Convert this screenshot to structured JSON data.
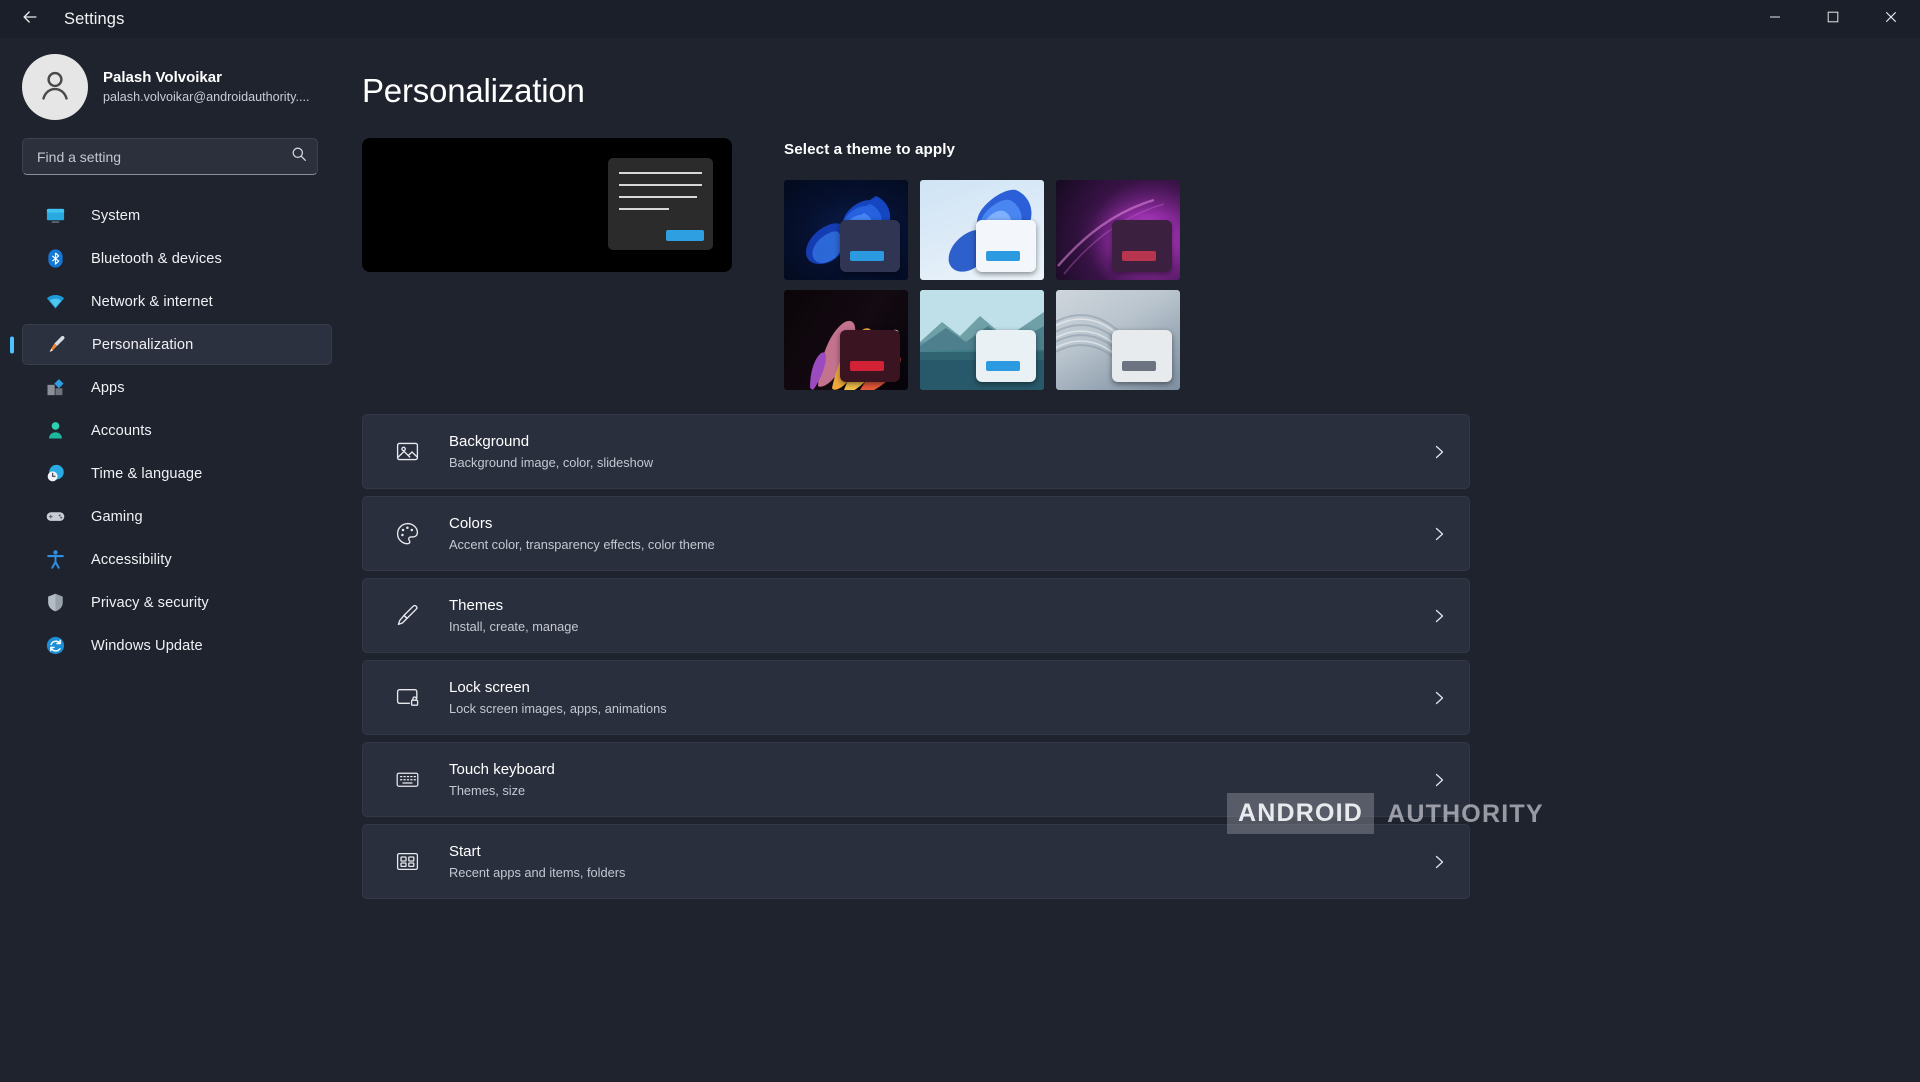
{
  "window": {
    "title": "Settings",
    "back_icon": "back-arrow-icon",
    "minimize_label": "–",
    "maximize_label": "☐",
    "close_label": "✕"
  },
  "account": {
    "name": "Palash Volvoikar",
    "email": "palash.volvoikar@androidauthority....",
    "avatar_icon": "user-avatar-icon"
  },
  "search": {
    "placeholder": "Find a setting",
    "value": "",
    "icon": "search-icon"
  },
  "sidebar": {
    "items": [
      {
        "label": "System",
        "icon": "system-monitor-icon",
        "active": false
      },
      {
        "label": "Bluetooth & devices",
        "icon": "bluetooth-icon",
        "active": false
      },
      {
        "label": "Network & internet",
        "icon": "wifi-icon",
        "active": false
      },
      {
        "label": "Personalization",
        "icon": "paintbrush-icon",
        "active": true
      },
      {
        "label": "Apps",
        "icon": "apps-icon",
        "active": false
      },
      {
        "label": "Accounts",
        "icon": "account-person-icon",
        "active": false
      },
      {
        "label": "Time & language",
        "icon": "clock-globe-icon",
        "active": false
      },
      {
        "label": "Gaming",
        "icon": "gamepad-icon",
        "active": false
      },
      {
        "label": "Accessibility",
        "icon": "accessibility-person-icon",
        "active": false
      },
      {
        "label": "Privacy & security",
        "icon": "shield-icon",
        "active": false
      },
      {
        "label": "Windows Update",
        "icon": "update-refresh-icon",
        "active": false
      }
    ]
  },
  "main": {
    "page_title": "Personalization",
    "themes_heading": "Select a theme to apply",
    "preview": {
      "name": "desktop-preview",
      "background_color": "#000000",
      "accent_color": "#2e9fe0"
    },
    "themes": [
      {
        "name": "windows-bloom-dark",
        "accent_color": "#2e9fe0",
        "window_color": "#2f3552"
      },
      {
        "name": "windows-bloom-light",
        "accent_color": "#2e9fe0",
        "window_color": "#f3f6fa"
      },
      {
        "name": "windows-glow",
        "accent_color": "#c83a52",
        "window_color": "#3b2040"
      },
      {
        "name": "windows-flow",
        "accent_color": "#d32236",
        "window_color": "#3a1420"
      },
      {
        "name": "captured-motion",
        "accent_color": "#2e9fe0",
        "window_color": "#e9f1f5"
      },
      {
        "name": "windows-sunrise",
        "accent_color": "#6b7480",
        "window_color": "#e8ebee"
      }
    ],
    "rows": [
      {
        "title": "Background",
        "subtitle": "Background image, color, slideshow",
        "icon": "picture-icon"
      },
      {
        "title": "Colors",
        "subtitle": "Accent color, transparency effects, color theme",
        "icon": "palette-icon"
      },
      {
        "title": "Themes",
        "subtitle": "Install, create, manage",
        "icon": "paintbrush-icon"
      },
      {
        "title": "Lock screen",
        "subtitle": "Lock screen images, apps, animations",
        "icon": "lock-screen-icon"
      },
      {
        "title": "Touch keyboard",
        "subtitle": "Themes, size",
        "icon": "keyboard-icon"
      },
      {
        "title": "Start",
        "subtitle": "Recent apps and items, folders",
        "icon": "start-grid-icon"
      }
    ],
    "chevron_icon": "chevron-right-icon"
  },
  "watermark": {
    "boxed_word": "ANDROID",
    "plain_word": "AUTHORITY"
  }
}
